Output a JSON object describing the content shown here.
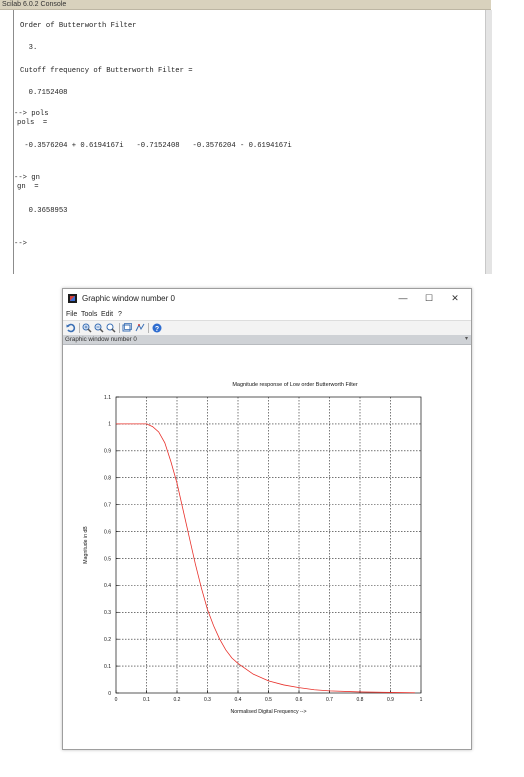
{
  "console": {
    "title": "Scilab 6.0.2 Console",
    "lines": [
      "Order of Butterworth Filter",
      "  3.",
      "Cutoff frequency of Butterworth Filter =",
      "  0.7152408",
      "--> pols",
      "pols  =",
      " -0.3576204 + 0.6194167i   -0.7152408   -0.3576204 - 0.6194167i",
      "--> gn",
      "gn  =",
      "  0.3658953",
      "-->"
    ]
  },
  "graphic_window": {
    "title": "Graphic window number 0",
    "controls": {
      "minimize": "—",
      "maximize": "☐",
      "close": "✕"
    },
    "menu": [
      "File",
      "Tools",
      "Edit",
      "?"
    ],
    "tab_label": "Graphic window number 0",
    "tab_arrow": "▾",
    "toolbar_icons": [
      "rotate-icon",
      "zoom-in-icon",
      "zoom-out-icon",
      "zoom-area-icon",
      "datatip-icon",
      "datatip-edit-icon",
      "help-icon"
    ]
  },
  "chart_data": {
    "type": "line",
    "title": "Magnitude response of Low order Butterworth Filter",
    "xlabel": "Normalised Digital Frequency -->",
    "ylabel": "Magnitude in dB",
    "xlim": [
      0,
      1
    ],
    "ylim": [
      0,
      1.1
    ],
    "xticks": [
      "0",
      "0.1",
      "0.2",
      "0.3",
      "0.4",
      "0.5",
      "0.6",
      "0.7",
      "0.8",
      "0.9",
      "1"
    ],
    "yticks": [
      "0",
      "0.1",
      "0.2",
      "0.3",
      "0.4",
      "0.5",
      "0.6",
      "0.7",
      "0.8",
      "0.9",
      "1",
      "1.1"
    ],
    "grid": true,
    "line_color": "#e8302a",
    "series": [
      {
        "x": [
          0,
          0.05,
          0.1,
          0.12,
          0.14,
          0.16,
          0.18,
          0.2,
          0.22,
          0.24,
          0.26,
          0.28,
          0.3,
          0.32,
          0.34,
          0.36,
          0.38,
          0.4,
          0.45,
          0.5,
          0.55,
          0.6,
          0.65,
          0.7,
          0.8,
          0.9,
          0.98
        ],
        "values": [
          1.0,
          1.0,
          1.0,
          0.99,
          0.97,
          0.93,
          0.86,
          0.78,
          0.68,
          0.58,
          0.48,
          0.39,
          0.31,
          0.25,
          0.2,
          0.16,
          0.13,
          0.11,
          0.07,
          0.045,
          0.03,
          0.02,
          0.012,
          0.008,
          0.004,
          0.002,
          0.001
        ]
      }
    ]
  }
}
